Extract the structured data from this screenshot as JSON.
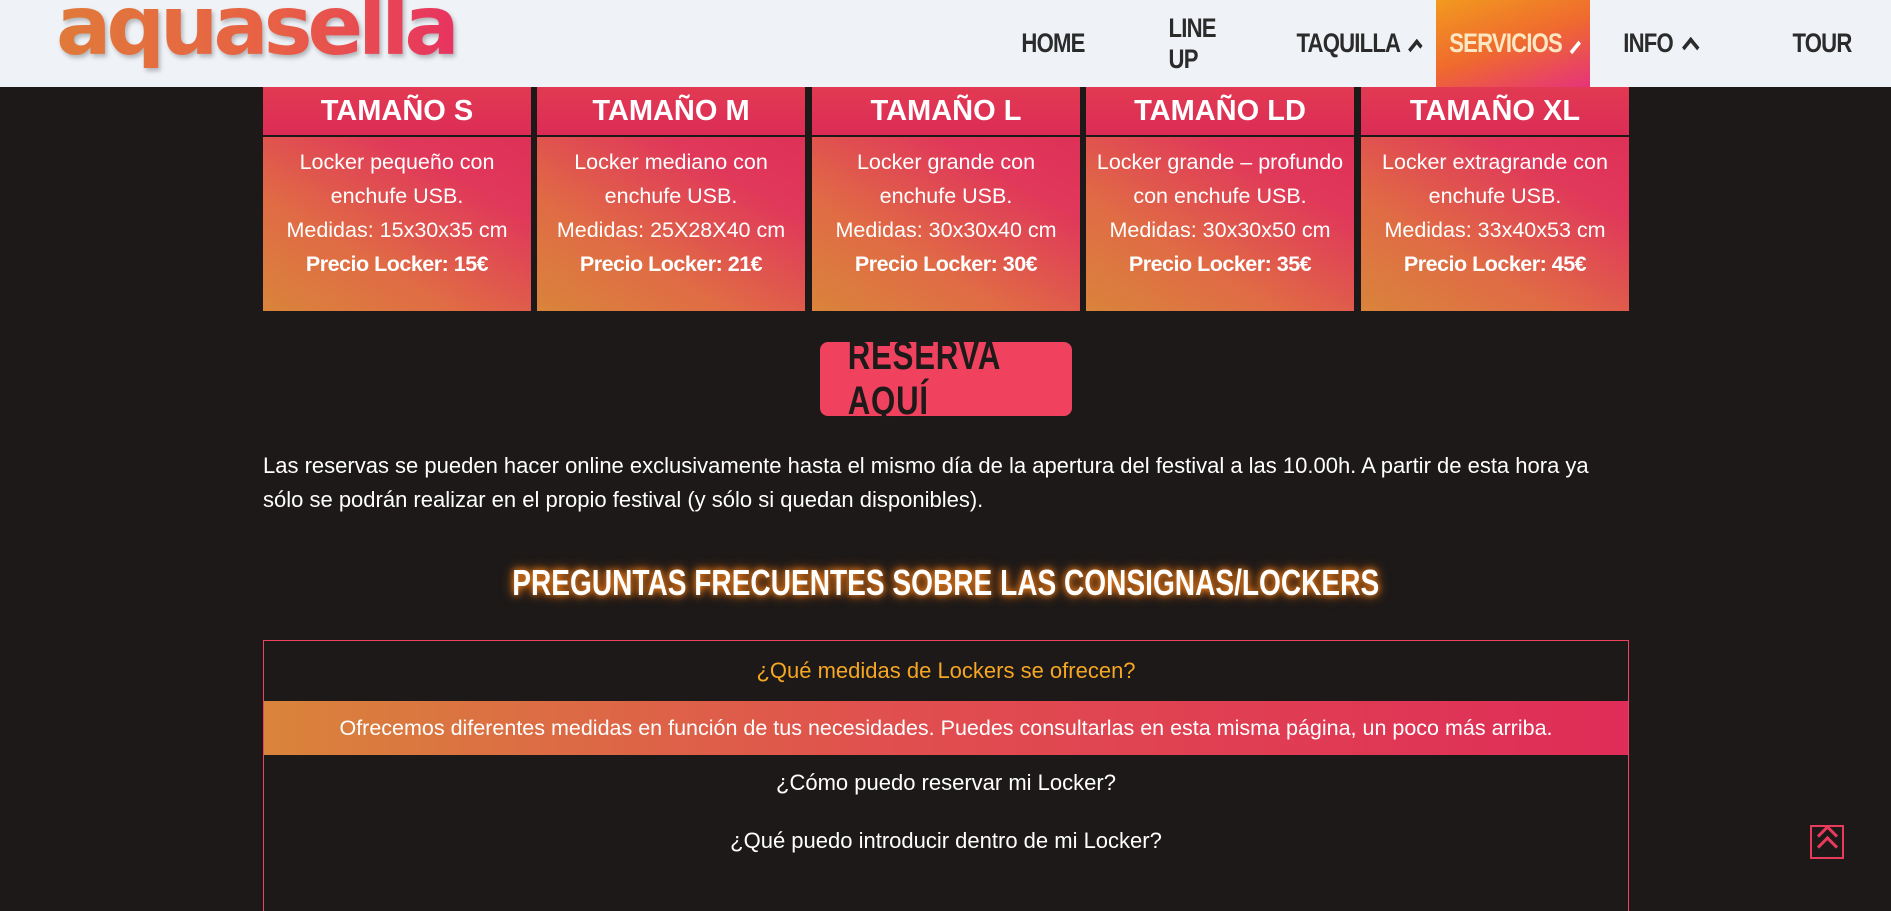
{
  "header": {
    "logo_text": "aquasella",
    "nav": [
      {
        "label": "HOME",
        "has_dropdown": false,
        "active": false
      },
      {
        "label": "LINE UP",
        "has_dropdown": false,
        "active": false
      },
      {
        "label": "TAQUILLA",
        "has_dropdown": true,
        "active": false
      },
      {
        "label": "SERVICIOS",
        "has_dropdown": true,
        "active": true
      },
      {
        "label": "INFO",
        "has_dropdown": true,
        "active": false
      },
      {
        "label": "TOUR",
        "has_dropdown": false,
        "active": false
      }
    ]
  },
  "lockers": [
    {
      "title": "TAMAÑO S",
      "line1": "Locker pequeño con",
      "line2": "enchufe USB.",
      "measures": "Medidas: 15x30x35 cm",
      "price": "Precio Locker: 15€"
    },
    {
      "title": "TAMAÑO M",
      "line1": "Locker mediano con",
      "line2": "enchufe USB.",
      "measures": "Medidas: 25X28X40 cm",
      "price": "Precio Locker: 21€"
    },
    {
      "title": "TAMAÑO L",
      "line1": "Locker grande con",
      "line2": "enchufe USB.",
      "measures": "Medidas: 30x30x40 cm",
      "price": "Precio Locker: 30€"
    },
    {
      "title": "TAMAÑO LD",
      "line1": "Locker grande – profundo",
      "line2": "con enchufe USB.",
      "measures": "Medidas: 30x30x50 cm",
      "price": "Precio Locker: 35€"
    },
    {
      "title": "TAMAÑO XL",
      "line1": "Locker extragrande con",
      "line2": "enchufe USB.",
      "measures": "Medidas: 33x40x53 cm",
      "price": "Precio Locker: 45€"
    }
  ],
  "reserve_button": "RESERVA AQUÍ",
  "info_text": "Las reservas se pueden hacer online exclusivamente hasta el mismo día de la apertura del festival a las 10.00h. A partir de esta hora ya sólo se podrán realizar en el propio festival (y sólo si quedan disponibles).",
  "faq": {
    "heading": "PREGUNTAS FRECUENTES SOBRE LAS CONSIGNAS/LOCKERS",
    "items": [
      {
        "question": "¿Qué medidas de Lockers se ofrecen?",
        "answer": "Ofrecemos diferentes medidas en función de tus necesidades. Puedes consultarlas en esta misma página, un poco más arriba.",
        "open": true
      },
      {
        "question": "¿Cómo puedo reservar mi Locker?",
        "open": false
      },
      {
        "question": "¿Qué puedo introducir dentro de mi Locker?",
        "open": false
      }
    ]
  },
  "colors": {
    "accent_pink": "#f0425f",
    "accent_orange": "#f5a623",
    "background": "#1c1918",
    "header_bg": "#eff2f7"
  },
  "icons": {
    "back_to_top": "double-chevron-up-icon",
    "dropdown": "chevron-up-icon"
  }
}
